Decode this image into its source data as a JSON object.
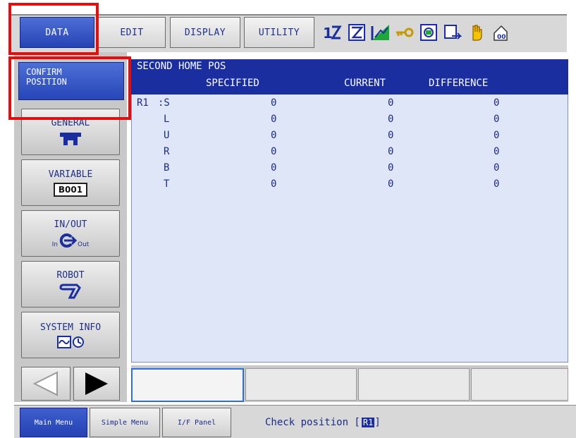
{
  "top_menu": {
    "items": [
      {
        "label": "DATA",
        "active": true
      },
      {
        "label": "EDIT",
        "active": false
      },
      {
        "label": "DISPLAY",
        "active": false
      },
      {
        "label": "UTILITY",
        "active": false
      }
    ]
  },
  "status_icons": [
    "step-icon",
    "cycle-icon",
    "mode-icon",
    "key-icon",
    "record-icon",
    "exit-icon",
    "hand-icon",
    "servo-icon"
  ],
  "side_menu": {
    "confirm": {
      "line1": "CONFIRM",
      "line2": "POSITION"
    },
    "general": {
      "label": "GENERAL"
    },
    "variable": {
      "label": "VARIABLE",
      "badge": "B001"
    },
    "inout": {
      "label": "IN/OUT",
      "in": "In",
      "out": "Out"
    },
    "robot": {
      "label": "ROBOT"
    },
    "system_info": {
      "label": "SYSTEM INFO"
    }
  },
  "panel": {
    "title": "SECOND HOME POS",
    "columns": {
      "specified": "SPECIFIED",
      "current": "CURRENT",
      "difference": "DIFFERENCE"
    },
    "group": "R1",
    "rows": [
      {
        "axis": ":S",
        "specified": "0",
        "current": "0",
        "difference": "0"
      },
      {
        "axis": "L",
        "specified": "0",
        "current": "0",
        "difference": "0"
      },
      {
        "axis": "U",
        "specified": "0",
        "current": "0",
        "difference": "0"
      },
      {
        "axis": "R",
        "specified": "0",
        "current": "0",
        "difference": "0"
      },
      {
        "axis": "B",
        "specified": "0",
        "current": "0",
        "difference": "0"
      },
      {
        "axis": "T",
        "specified": "0",
        "current": "0",
        "difference": "0"
      }
    ]
  },
  "bottom": {
    "main_menu": "Main Menu",
    "simple_menu": "Simple Menu",
    "if_panel": "I/F Panel",
    "message": "Check position [",
    "message_badge": "R1",
    "message_end": "]"
  },
  "colors": {
    "accent": "#2643b4",
    "highlight": "#e01010",
    "panel_bg": "#dfe6f7"
  }
}
